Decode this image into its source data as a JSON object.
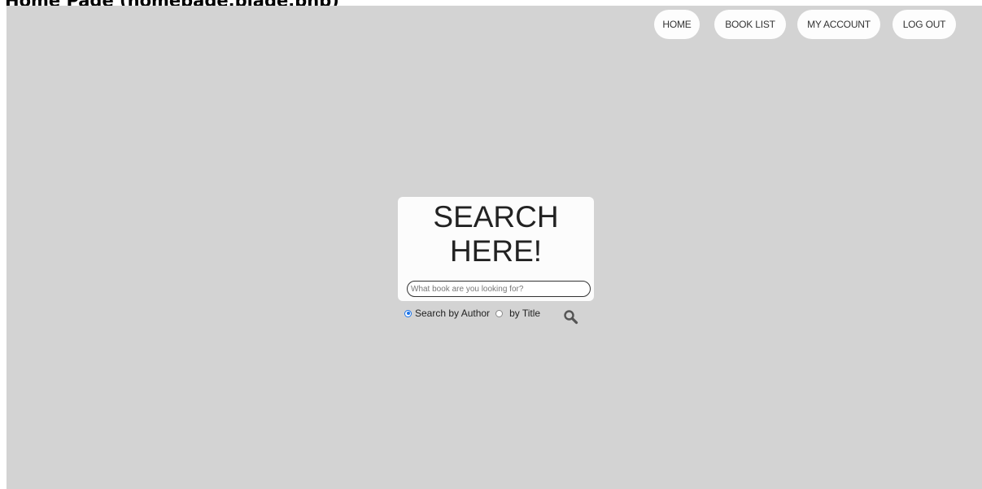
{
  "caption": "Home Page (homepage.blade.php)",
  "nav": {
    "home": "HOME",
    "book_list": "BOOK LIST",
    "my_account": "MY ACCOUNT",
    "log_out": "LOG OUT"
  },
  "search": {
    "title_line1": "SEARCH",
    "title_line2": "HERE!",
    "placeholder": "What book are you looking for?",
    "option_author": "Search by Author",
    "option_title": "by Title",
    "selected_option": "author",
    "button_icon": "magnifier-icon"
  },
  "colors": {
    "page_background": "#d3d3d3",
    "card_background": "#fcfcfc",
    "radio_accent": "#1a73e8"
  }
}
